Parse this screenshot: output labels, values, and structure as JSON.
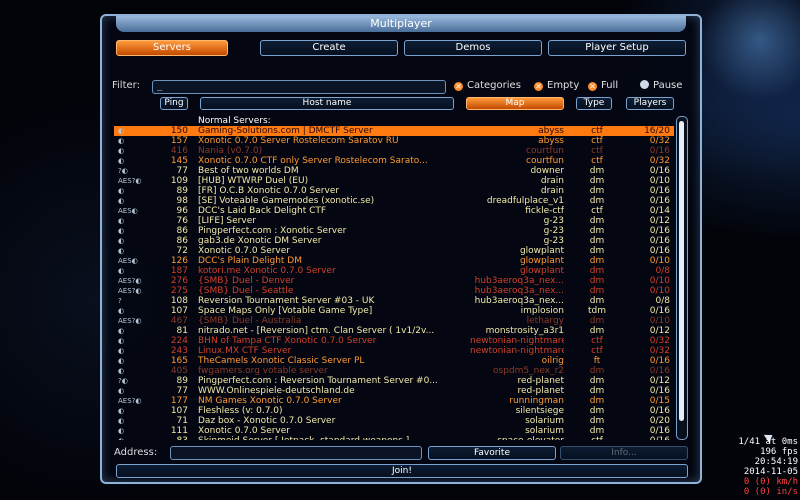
{
  "window": {
    "title": "Multiplayer"
  },
  "tabs": [
    {
      "label": "Servers",
      "active": true
    },
    {
      "label": "Create",
      "active": false
    },
    {
      "label": "Demos",
      "active": false
    },
    {
      "label": "Player Setup",
      "active": false
    }
  ],
  "filter": {
    "label": "Filter:",
    "value": "_"
  },
  "checks": [
    {
      "label": "Categories",
      "checked": true
    },
    {
      "label": "Empty",
      "checked": true
    },
    {
      "label": "Full",
      "checked": true
    },
    {
      "label": "Pause",
      "checked": false
    }
  ],
  "columns": {
    "ping": "Ping",
    "host": "Host name",
    "map": "Map",
    "type": "Type",
    "players": "Players"
  },
  "group_title": "Normal Servers:",
  "servers": [
    {
      "icons": "◐",
      "ping": "150",
      "name": "Gaming-Solutions.com | DMCTF Server",
      "map": "abyss",
      "type": "ctf",
      "players": "16/20",
      "c": "sel"
    },
    {
      "icons": "◐",
      "ping": "157",
      "name": "Xonotic 0.7.0 Server Rostelecom Saratov RU",
      "map": "abyss",
      "type": "ctf",
      "players": "0/32",
      "c": "orange"
    },
    {
      "icons": "◐",
      "ping": "416",
      "name": "Nania (v0.7.0)",
      "map": "courtfun",
      "type": "ctf",
      "players": "0/16",
      "c": "dim"
    },
    {
      "icons": "◐",
      "ping": "145",
      "name": "Xonotic 0.7.0 CTF only Server Rostelecom Sarato...",
      "map": "courtfun",
      "type": "ctf",
      "players": "0/32",
      "c": "orange"
    },
    {
      "icons": "?◐",
      "ping": "77",
      "name": "Best of two worlds DM",
      "map": "downer",
      "type": "dm",
      "players": "0/16",
      "c": "yellow"
    },
    {
      "icons": "AES?◐",
      "ping": "109",
      "name": "[HUB] WTWRP Duel (EU)",
      "map": "drain",
      "type": "dm",
      "players": "0/10",
      "c": "yellow"
    },
    {
      "icons": "◐",
      "ping": "89",
      "name": "[FR] O.C.B Xonotic 0.7.0 Server",
      "map": "drain",
      "type": "dm",
      "players": "0/16",
      "c": "yellow"
    },
    {
      "icons": "◐",
      "ping": "98",
      "name": "[SE] Voteable Gamemodes (xonotic.se)",
      "map": "dreadfulplace_v1",
      "type": "dm",
      "players": "0/16",
      "c": "yellow"
    },
    {
      "icons": "AES◐",
      "ping": "96",
      "name": "DCC's Laid Back Delight CTF",
      "map": "fickle-ctf",
      "type": "ctf",
      "players": "0/14",
      "c": "yellow"
    },
    {
      "icons": "◐",
      "ping": "76",
      "name": "[LIFE] Server",
      "map": "g-23",
      "type": "dm",
      "players": "0/12",
      "c": "yellow"
    },
    {
      "icons": "◐",
      "ping": "86",
      "name": "Pingperfect.com : Xonotic Server",
      "map": "g-23",
      "type": "dm",
      "players": "0/16",
      "c": "yellow"
    },
    {
      "icons": "◐",
      "ping": "86",
      "name": "gab3.de Xonotic DM Server",
      "map": "g-23",
      "type": "dm",
      "players": "0/16",
      "c": "yellow"
    },
    {
      "icons": "◐",
      "ping": "72",
      "name": "Xonotic 0.7.0 Server",
      "map": "glowplant",
      "type": "dm",
      "players": "0/16",
      "c": "yellow"
    },
    {
      "icons": "AES◐",
      "ping": "126",
      "name": "DCC's Plain Delight DM",
      "map": "glowplant",
      "type": "dm",
      "players": "0/10",
      "c": "orange"
    },
    {
      "icons": "◐",
      "ping": "187",
      "name": "kotori.me Xonotic 0.7.0 Server",
      "map": "glowplant",
      "type": "dm",
      "players": "0/8",
      "c": "red"
    },
    {
      "icons": "AES?◐",
      "ping": "276",
      "name": "{SMB} Duel - Denver",
      "map": "hub3aeroq3a_nex...",
      "type": "dm",
      "players": "0/10",
      "c": "red"
    },
    {
      "icons": "AES?◐",
      "ping": "275",
      "name": "{SMB} Duel - Seattle",
      "map": "hub3aeroq3a_nex...",
      "type": "dm",
      "players": "0/10",
      "c": "red"
    },
    {
      "icons": "?",
      "ping": "108",
      "name": "Reversion Tournament Server #03 - UK",
      "map": "hub3aeroq3a_nex...",
      "type": "dm",
      "players": "0/8",
      "c": "yellow"
    },
    {
      "icons": "◐",
      "ping": "107",
      "name": "Space Maps Only [Votable Game Type]",
      "map": "implosion",
      "type": "tdm",
      "players": "0/16",
      "c": "yellow"
    },
    {
      "icons": "AES?◐",
      "ping": "467",
      "name": "{SMB} Duel - Australia",
      "map": "lethargy",
      "type": "dm",
      "players": "0/10",
      "c": "dim"
    },
    {
      "icons": "◐",
      "ping": "81",
      "name": "nitrado.net - [Reversion] ctm. Clan Server ( 1v1/2v...",
      "map": "monstrosity_a3r1",
      "type": "dm",
      "players": "0/12",
      "c": "yellow"
    },
    {
      "icons": "◐",
      "ping": "224",
      "name": "BHN of Tampa CTF Xonotic 0.7.0 Server",
      "map": "newtonian-nightmare",
      "type": "ctf",
      "players": "0/32",
      "c": "red"
    },
    {
      "icons": "◐",
      "ping": "243",
      "name": "Linux.MX CTF Server",
      "map": "newtonian-nightmare",
      "type": "ctf",
      "players": "0/32",
      "c": "red"
    },
    {
      "icons": "◐",
      "ping": "165",
      "name": "TheCamels Xonotic Classic Server PL",
      "map": "oilrig",
      "type": "ft",
      "players": "0/16",
      "c": "orange"
    },
    {
      "icons": "◐",
      "ping": "405",
      "name": "fwgamers.org votable server",
      "map": "ospdm5_nex_r2",
      "type": "dm",
      "players": "0/16",
      "c": "dim"
    },
    {
      "icons": "?◐",
      "ping": "89",
      "name": "Pingperfect.com : Reversion Tournament Server #0...",
      "map": "red-planet",
      "type": "dm",
      "players": "0/12",
      "c": "yellow"
    },
    {
      "icons": "◐",
      "ping": "77",
      "name": "WWW.Onlinespiele-deutschland.de",
      "map": "red-planet",
      "type": "dm",
      "players": "0/16",
      "c": "yellow"
    },
    {
      "icons": "AES?◐",
      "ping": "177",
      "name": "NM Games Xonotic 0.7.0 Server",
      "map": "runningman",
      "type": "dm",
      "players": "0/15",
      "c": "orange"
    },
    {
      "icons": "◐",
      "ping": "107",
      "name": "Fleshless (v: 0.7.0)",
      "map": "silentsiege",
      "type": "dm",
      "players": "0/16",
      "c": "yellow"
    },
    {
      "icons": "◐",
      "ping": "71",
      "name": "Daz box - Xonotic 0.7.0 Server",
      "map": "solarium",
      "type": "dm",
      "players": "0/20",
      "c": "yellow"
    },
    {
      "icons": "◐",
      "ping": "111",
      "name": "Xonotic 0.7.0 Server",
      "map": "solarium",
      "type": "dm",
      "players": "0/16",
      "c": "yellow"
    },
    {
      "icons": "◐",
      "ping": "83",
      "name": "Skinmeid Server [ Jetpack, standard weapons ]",
      "map": "space-elevator",
      "type": "ctf",
      "players": "0/16",
      "c": "yellow"
    }
  ],
  "address": {
    "label": "Address:"
  },
  "buttons": {
    "favorite": "Favorite",
    "info": "Info...",
    "join": "Join!"
  },
  "hud": [
    "1/41 at 0ms",
    "196 fps",
    "20:54:19",
    "2014-11-05",
    "0 (0) km/h",
    "0 (0) in/s"
  ]
}
